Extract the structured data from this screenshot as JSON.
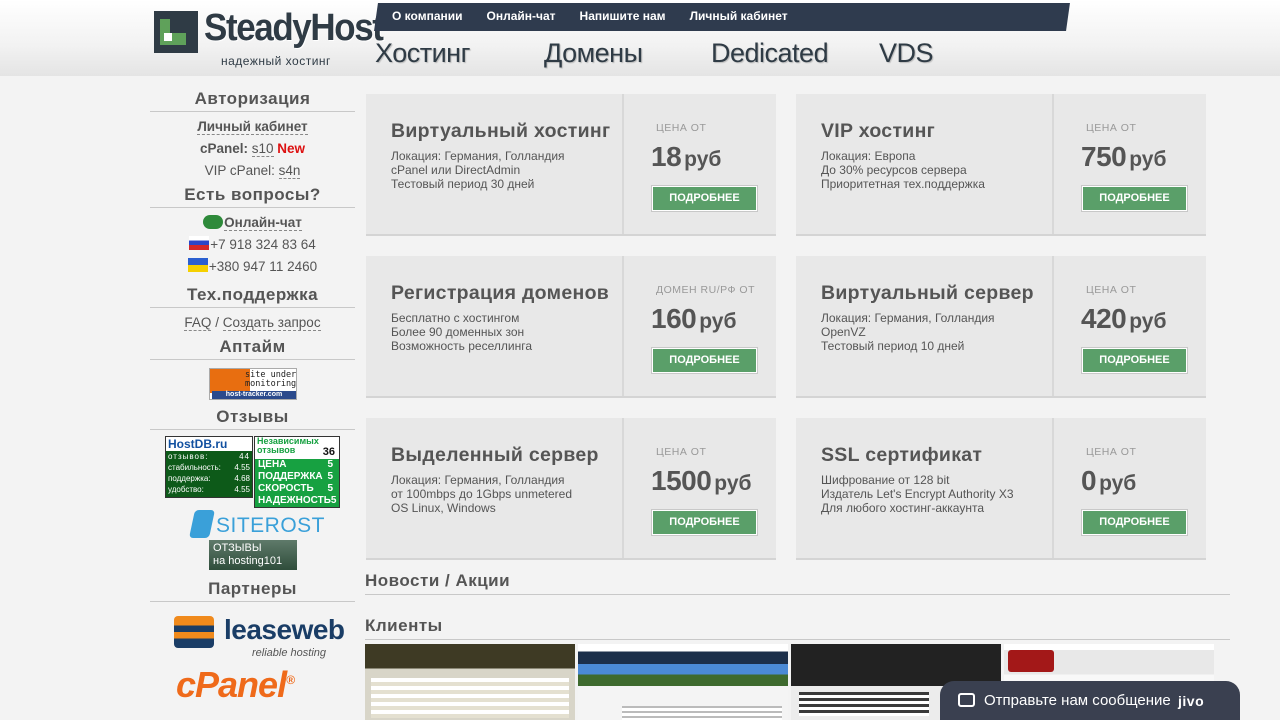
{
  "brand": {
    "name": "SteadyHost",
    "tagline": "надежный хостинг"
  },
  "top_nav": [
    "О компании",
    "Онлайн-чат",
    "Напишите нам",
    "Личный кабинет"
  ],
  "main_nav": [
    "Хостинг",
    "Домены",
    "Dedicated",
    "VDS"
  ],
  "sidebar": {
    "auth_heading": "Авторизация",
    "cabinet_link": "Личный кабинет",
    "cpanel_label": "cPanel:",
    "cpanel_server": "s10",
    "cpanel_new": "New",
    "vip_cpanel_label": "VIP cPanel:",
    "vip_cpanel_server": "s4n",
    "questions_heading": "Есть вопросы?",
    "chat_link": "Онлайн-чат",
    "phone_ru": "+7 918 324 83 64",
    "phone_ua": "+380 947 11 2460",
    "support_heading": "Тех.поддержка",
    "faq_link": "FAQ",
    "separator": "/",
    "ticket_link": "Создать запрос",
    "uptime_heading": "Аптайм",
    "uptime_badge_line1": "site under",
    "uptime_badge_line2": "monitoring",
    "uptime_badge_site": "host-tracker.com",
    "reviews_heading": "Отзывы",
    "hostdb": {
      "title": "HostDB.ru",
      "rows": [
        {
          "label": "отзывов:",
          "value": "44"
        },
        {
          "label": "стабильность:",
          "value": "4.55"
        },
        {
          "label": "поддержка:",
          "value": "4.68"
        },
        {
          "label": "удобство:",
          "value": "4.55"
        }
      ]
    },
    "independent": {
      "title": "Независимых отзывов",
      "count": "36",
      "rows": [
        {
          "label": "ЦЕНА",
          "value": "5"
        },
        {
          "label": "ПОДДЕРЖКА",
          "value": "5"
        },
        {
          "label": "СКОРОСТЬ",
          "value": "5"
        },
        {
          "label": "НАДЕЖНОСТЬ",
          "value": "5"
        }
      ]
    },
    "siterost": "SITEROST",
    "hosting101_line1": "ОТЗЫВЫ",
    "hosting101_line2": "на hosting101",
    "partners_heading": "Партнеры",
    "leaseweb_name": "leaseweb",
    "leaseweb_tag": "reliable hosting",
    "cpanel_logo": "cPanel"
  },
  "cards": [
    {
      "title": "Виртуальный хостинг",
      "lines": [
        "Локация: Германия, Голландия",
        "cPanel или DirectAdmin",
        "Тестовый период 30 дней"
      ],
      "price_label": "ЦЕНА ОТ",
      "price": "18",
      "currency": "руб",
      "button": "ПОДРОБНЕЕ"
    },
    {
      "title": "VIP хостинг",
      "lines": [
        "Локация: Европа",
        "До 30% ресурсов сервера",
        "Приоритетная тех.поддержка"
      ],
      "price_label": "ЦЕНА ОТ",
      "price": "750",
      "currency": "руб",
      "button": "ПОДРОБНЕЕ"
    },
    {
      "title": "Регистрация доменов",
      "lines": [
        "Бесплатно с хостингом",
        "Более 90 доменных зон",
        "Возможность реселлинга"
      ],
      "price_label": "ДОМЕН RU/РФ ОТ",
      "price": "160",
      "currency": "руб",
      "button": "ПОДРОБНЕЕ"
    },
    {
      "title": "Виртуальный сервер",
      "lines": [
        "Локация: Германия, Голландия",
        "OpenVZ",
        "Тестовый период 10 дней"
      ],
      "price_label": "ЦЕНА ОТ",
      "price": "420",
      "currency": "руб",
      "button": "ПОДРОБНЕЕ"
    },
    {
      "title": "Выделенный сервер",
      "lines": [
        "Локация: Германия, Голландия",
        "от 100mbps до 1Gbps unmetered",
        "OS Linux, Windows"
      ],
      "price_label": "ЦЕНА ОТ",
      "price": "1500",
      "currency": "руб",
      "button": "ПОДРОБНЕЕ"
    },
    {
      "title": "SSL сертификат",
      "lines": [
        "Шифрование от 128 bit",
        "Издатель Let's Encrypt Authority X3",
        "Для любого хостинг-аккаунта"
      ],
      "price_label": "ЦЕНА ОТ",
      "price": "0",
      "currency": "руб",
      "button": "ПОДРОБНЕЕ"
    }
  ],
  "sections": {
    "news": "Новости / Акции",
    "clients": "Клиенты"
  },
  "chat_widget": {
    "text": "Отправьте нам сообщение",
    "brand": "jivo"
  },
  "colors": {
    "accent_green": "#5a9f69",
    "nav_dark": "#2f3b4e",
    "new_red": "#d11111"
  }
}
